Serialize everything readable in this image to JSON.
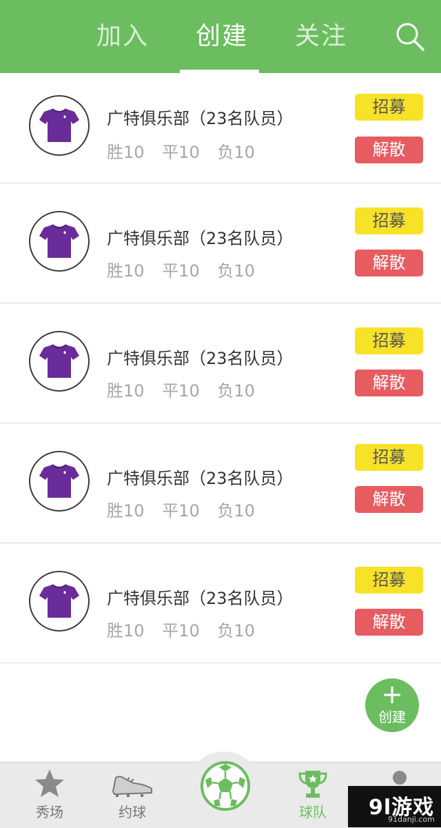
{
  "header": {
    "tabs": [
      {
        "label": "加入",
        "active": false
      },
      {
        "label": "创建",
        "active": true
      },
      {
        "label": "关注",
        "active": false
      }
    ],
    "search_icon": "search-icon"
  },
  "teams": [
    {
      "name": "广特俱乐部（23名队员）",
      "wins": "胜10",
      "draws": "平10",
      "losses": "负10",
      "recruit_label": "招募",
      "disband_label": "解散"
    },
    {
      "name": "广特俱乐部（23名队员）",
      "wins": "胜10",
      "draws": "平10",
      "losses": "负10",
      "recruit_label": "招募",
      "disband_label": "解散"
    },
    {
      "name": "广特俱乐部（23名队员）",
      "wins": "胜10",
      "draws": "平10",
      "losses": "负10",
      "recruit_label": "招募",
      "disband_label": "解散"
    },
    {
      "name": "广特俱乐部（23名队员）",
      "wins": "胜10",
      "draws": "平10",
      "losses": "负10",
      "recruit_label": "招募",
      "disband_label": "解散"
    },
    {
      "name": "广特俱乐部（23名队员）",
      "wins": "胜10",
      "draws": "平10",
      "losses": "负10",
      "recruit_label": "招募",
      "disband_label": "解散"
    }
  ],
  "fab": {
    "label": "创建"
  },
  "bottom_nav": {
    "items": [
      {
        "label": "秀场",
        "icon": "star-icon",
        "active": false
      },
      {
        "label": "约球",
        "icon": "soccer-shoe-icon",
        "active": false
      },
      {
        "label": "球队",
        "icon": "trophy-icon",
        "active": true
      },
      {
        "label": "",
        "icon": "user-icon",
        "active": false
      }
    ],
    "center_icon": "soccer-ball-icon"
  },
  "watermark": {
    "logo": "9l游戏",
    "url": "91danji.com"
  },
  "colors": {
    "primary": "#6bbd5f",
    "recruit": "#f7e227",
    "disband": "#e75c61",
    "jersey": "#6a2c99"
  }
}
